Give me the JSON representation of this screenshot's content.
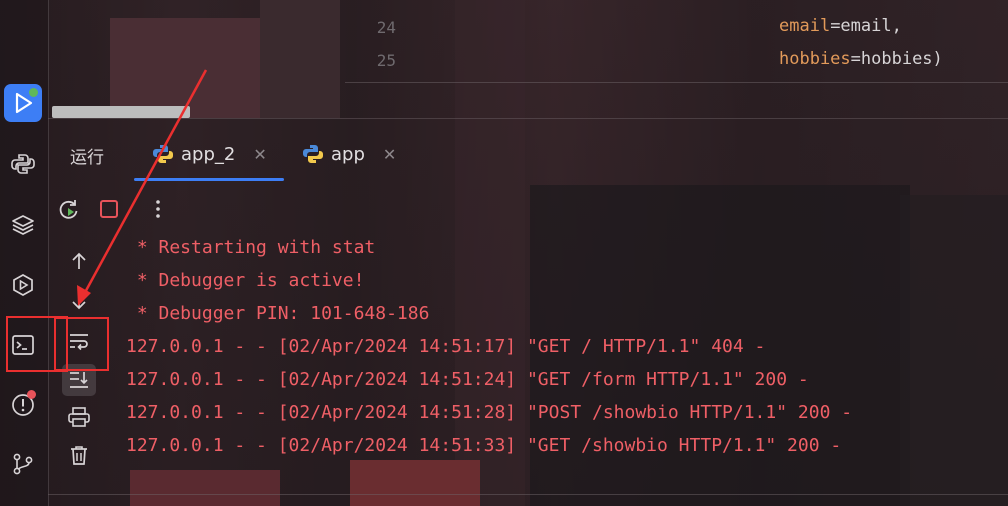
{
  "colors": {
    "accent": "#3d7ef5",
    "console_text": "#ef5f66",
    "param": "#e29a5a",
    "annotation": "#ea2f2f"
  },
  "sidebar": {
    "items": [
      {
        "icon": "run-icon",
        "active": true,
        "badge": "green"
      },
      {
        "icon": "python-console-icon"
      },
      {
        "icon": "layers-icon"
      },
      {
        "icon": "services-icon"
      },
      {
        "icon": "terminal-icon"
      },
      {
        "icon": "problems-icon",
        "badge": "red"
      },
      {
        "icon": "git-icon"
      }
    ]
  },
  "editor": {
    "lines": [
      {
        "number": "24",
        "param": "email",
        "rest": "=email,"
      },
      {
        "number": "25",
        "param": "hobbies",
        "rest": "=hobbies)"
      }
    ]
  },
  "run_panel": {
    "title": "运行",
    "tabs": [
      {
        "label": "app_2",
        "active": true,
        "close": "✕"
      },
      {
        "label": "app",
        "active": false,
        "close": "✕"
      }
    ]
  },
  "console": {
    "lines": [
      " * Restarting with stat",
      " * Debugger is active!",
      " * Debugger PIN: 101-648-186",
      "127.0.0.1 - - [02/Apr/2024 14:51:17] \"GET / HTTP/1.1\" 404 -",
      "127.0.0.1 - - [02/Apr/2024 14:51:24] \"GET /form HTTP/1.1\" 200 -",
      "127.0.0.1 - - [02/Apr/2024 14:51:28] \"POST /showbio HTTP/1.1\" 200 -",
      "127.0.0.1 - - [02/Apr/2024 14:51:33] \"GET /showbio HTTP/1.1\" 200 -"
    ]
  },
  "toolbar_icons": [
    "rerun-icon",
    "stop-icon",
    "more-icon",
    "scroll-up-icon",
    "scroll-down-icon",
    "soft-wrap-icon",
    "scroll-to-end-icon",
    "print-icon",
    "clear-icon"
  ]
}
